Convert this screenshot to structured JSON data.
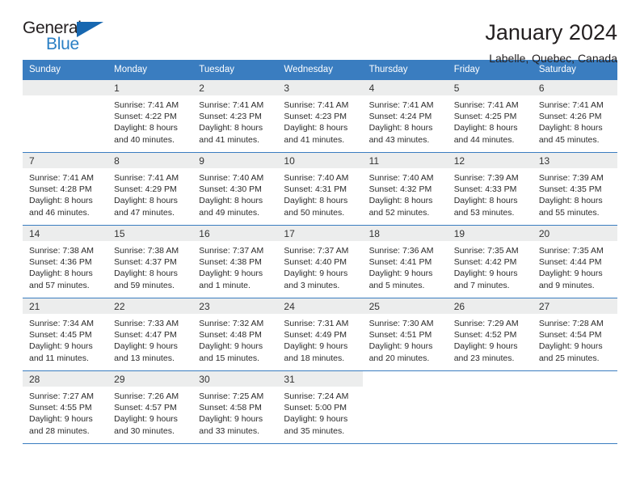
{
  "brand": {
    "name_part1": "General",
    "name_part2": "Blue",
    "triangle_color": "#1767b0",
    "blue_text_color": "#2a7fc4"
  },
  "header": {
    "title": "January 2024",
    "subtitle": "Labelle, Quebec, Canada"
  },
  "calendar": {
    "header_bg": "#3a7dc0",
    "daynum_bg": "#eceded",
    "weekdays": [
      "Sunday",
      "Monday",
      "Tuesday",
      "Wednesday",
      "Thursday",
      "Friday",
      "Saturday"
    ],
    "weeks": [
      [
        {
          "day": "",
          "sunrise": "",
          "sunset": "",
          "daylight_line1": "",
          "daylight_line2": ""
        },
        {
          "day": "1",
          "sunrise": "Sunrise: 7:41 AM",
          "sunset": "Sunset: 4:22 PM",
          "daylight_line1": "Daylight: 8 hours",
          "daylight_line2": "and 40 minutes."
        },
        {
          "day": "2",
          "sunrise": "Sunrise: 7:41 AM",
          "sunset": "Sunset: 4:23 PM",
          "daylight_line1": "Daylight: 8 hours",
          "daylight_line2": "and 41 minutes."
        },
        {
          "day": "3",
          "sunrise": "Sunrise: 7:41 AM",
          "sunset": "Sunset: 4:23 PM",
          "daylight_line1": "Daylight: 8 hours",
          "daylight_line2": "and 41 minutes."
        },
        {
          "day": "4",
          "sunrise": "Sunrise: 7:41 AM",
          "sunset": "Sunset: 4:24 PM",
          "daylight_line1": "Daylight: 8 hours",
          "daylight_line2": "and 43 minutes."
        },
        {
          "day": "5",
          "sunrise": "Sunrise: 7:41 AM",
          "sunset": "Sunset: 4:25 PM",
          "daylight_line1": "Daylight: 8 hours",
          "daylight_line2": "and 44 minutes."
        },
        {
          "day": "6",
          "sunrise": "Sunrise: 7:41 AM",
          "sunset": "Sunset: 4:26 PM",
          "daylight_line1": "Daylight: 8 hours",
          "daylight_line2": "and 45 minutes."
        }
      ],
      [
        {
          "day": "7",
          "sunrise": "Sunrise: 7:41 AM",
          "sunset": "Sunset: 4:28 PM",
          "daylight_line1": "Daylight: 8 hours",
          "daylight_line2": "and 46 minutes."
        },
        {
          "day": "8",
          "sunrise": "Sunrise: 7:41 AM",
          "sunset": "Sunset: 4:29 PM",
          "daylight_line1": "Daylight: 8 hours",
          "daylight_line2": "and 47 minutes."
        },
        {
          "day": "9",
          "sunrise": "Sunrise: 7:40 AM",
          "sunset": "Sunset: 4:30 PM",
          "daylight_line1": "Daylight: 8 hours",
          "daylight_line2": "and 49 minutes."
        },
        {
          "day": "10",
          "sunrise": "Sunrise: 7:40 AM",
          "sunset": "Sunset: 4:31 PM",
          "daylight_line1": "Daylight: 8 hours",
          "daylight_line2": "and 50 minutes."
        },
        {
          "day": "11",
          "sunrise": "Sunrise: 7:40 AM",
          "sunset": "Sunset: 4:32 PM",
          "daylight_line1": "Daylight: 8 hours",
          "daylight_line2": "and 52 minutes."
        },
        {
          "day": "12",
          "sunrise": "Sunrise: 7:39 AM",
          "sunset": "Sunset: 4:33 PM",
          "daylight_line1": "Daylight: 8 hours",
          "daylight_line2": "and 53 minutes."
        },
        {
          "day": "13",
          "sunrise": "Sunrise: 7:39 AM",
          "sunset": "Sunset: 4:35 PM",
          "daylight_line1": "Daylight: 8 hours",
          "daylight_line2": "and 55 minutes."
        }
      ],
      [
        {
          "day": "14",
          "sunrise": "Sunrise: 7:38 AM",
          "sunset": "Sunset: 4:36 PM",
          "daylight_line1": "Daylight: 8 hours",
          "daylight_line2": "and 57 minutes."
        },
        {
          "day": "15",
          "sunrise": "Sunrise: 7:38 AM",
          "sunset": "Sunset: 4:37 PM",
          "daylight_line1": "Daylight: 8 hours",
          "daylight_line2": "and 59 minutes."
        },
        {
          "day": "16",
          "sunrise": "Sunrise: 7:37 AM",
          "sunset": "Sunset: 4:38 PM",
          "daylight_line1": "Daylight: 9 hours",
          "daylight_line2": "and 1 minute."
        },
        {
          "day": "17",
          "sunrise": "Sunrise: 7:37 AM",
          "sunset": "Sunset: 4:40 PM",
          "daylight_line1": "Daylight: 9 hours",
          "daylight_line2": "and 3 minutes."
        },
        {
          "day": "18",
          "sunrise": "Sunrise: 7:36 AM",
          "sunset": "Sunset: 4:41 PM",
          "daylight_line1": "Daylight: 9 hours",
          "daylight_line2": "and 5 minutes."
        },
        {
          "day": "19",
          "sunrise": "Sunrise: 7:35 AM",
          "sunset": "Sunset: 4:42 PM",
          "daylight_line1": "Daylight: 9 hours",
          "daylight_line2": "and 7 minutes."
        },
        {
          "day": "20",
          "sunrise": "Sunrise: 7:35 AM",
          "sunset": "Sunset: 4:44 PM",
          "daylight_line1": "Daylight: 9 hours",
          "daylight_line2": "and 9 minutes."
        }
      ],
      [
        {
          "day": "21",
          "sunrise": "Sunrise: 7:34 AM",
          "sunset": "Sunset: 4:45 PM",
          "daylight_line1": "Daylight: 9 hours",
          "daylight_line2": "and 11 minutes."
        },
        {
          "day": "22",
          "sunrise": "Sunrise: 7:33 AM",
          "sunset": "Sunset: 4:47 PM",
          "daylight_line1": "Daylight: 9 hours",
          "daylight_line2": "and 13 minutes."
        },
        {
          "day": "23",
          "sunrise": "Sunrise: 7:32 AM",
          "sunset": "Sunset: 4:48 PM",
          "daylight_line1": "Daylight: 9 hours",
          "daylight_line2": "and 15 minutes."
        },
        {
          "day": "24",
          "sunrise": "Sunrise: 7:31 AM",
          "sunset": "Sunset: 4:49 PM",
          "daylight_line1": "Daylight: 9 hours",
          "daylight_line2": "and 18 minutes."
        },
        {
          "day": "25",
          "sunrise": "Sunrise: 7:30 AM",
          "sunset": "Sunset: 4:51 PM",
          "daylight_line1": "Daylight: 9 hours",
          "daylight_line2": "and 20 minutes."
        },
        {
          "day": "26",
          "sunrise": "Sunrise: 7:29 AM",
          "sunset": "Sunset: 4:52 PM",
          "daylight_line1": "Daylight: 9 hours",
          "daylight_line2": "and 23 minutes."
        },
        {
          "day": "27",
          "sunrise": "Sunrise: 7:28 AM",
          "sunset": "Sunset: 4:54 PM",
          "daylight_line1": "Daylight: 9 hours",
          "daylight_line2": "and 25 minutes."
        }
      ],
      [
        {
          "day": "28",
          "sunrise": "Sunrise: 7:27 AM",
          "sunset": "Sunset: 4:55 PM",
          "daylight_line1": "Daylight: 9 hours",
          "daylight_line2": "and 28 minutes."
        },
        {
          "day": "29",
          "sunrise": "Sunrise: 7:26 AM",
          "sunset": "Sunset: 4:57 PM",
          "daylight_line1": "Daylight: 9 hours",
          "daylight_line2": "and 30 minutes."
        },
        {
          "day": "30",
          "sunrise": "Sunrise: 7:25 AM",
          "sunset": "Sunset: 4:58 PM",
          "daylight_line1": "Daylight: 9 hours",
          "daylight_line2": "and 33 minutes."
        },
        {
          "day": "31",
          "sunrise": "Sunrise: 7:24 AM",
          "sunset": "Sunset: 5:00 PM",
          "daylight_line1": "Daylight: 9 hours",
          "daylight_line2": "and 35 minutes."
        },
        {
          "day": "",
          "sunrise": "",
          "sunset": "",
          "daylight_line1": "",
          "daylight_line2": ""
        },
        {
          "day": "",
          "sunrise": "",
          "sunset": "",
          "daylight_line1": "",
          "daylight_line2": ""
        },
        {
          "day": "",
          "sunrise": "",
          "sunset": "",
          "daylight_line1": "",
          "daylight_line2": ""
        }
      ]
    ]
  }
}
